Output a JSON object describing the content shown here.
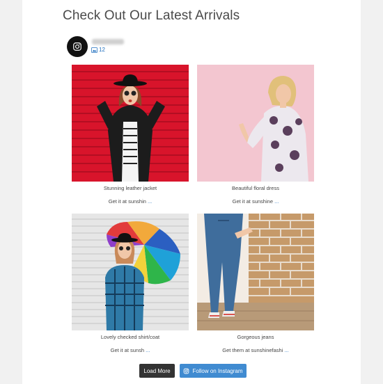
{
  "header": {
    "title": "Check Out Our Latest Arrivals"
  },
  "profile": {
    "media_count": "12",
    "icon": "instagram-icon"
  },
  "posts": [
    {
      "caption": "Stunning leather jacket",
      "link_text": "Get it at sunshin",
      "more": "..."
    },
    {
      "caption": "Beautiful floral dress",
      "link_text": "Get it at sunshine",
      "more": "..."
    },
    {
      "caption": "Lovely checked shirt/coat",
      "link_text": "Get it at sunsh",
      "more": "..."
    },
    {
      "caption": "Gorgeous jeans",
      "link_text": "Get them at sunshinefashi",
      "more": "..."
    }
  ],
  "buttons": {
    "load_more": "Load More",
    "follow": "Follow on Instagram"
  },
  "colors": {
    "accent": "#408bd1",
    "dark_button": "#333333",
    "link": "#1f6fbf"
  }
}
